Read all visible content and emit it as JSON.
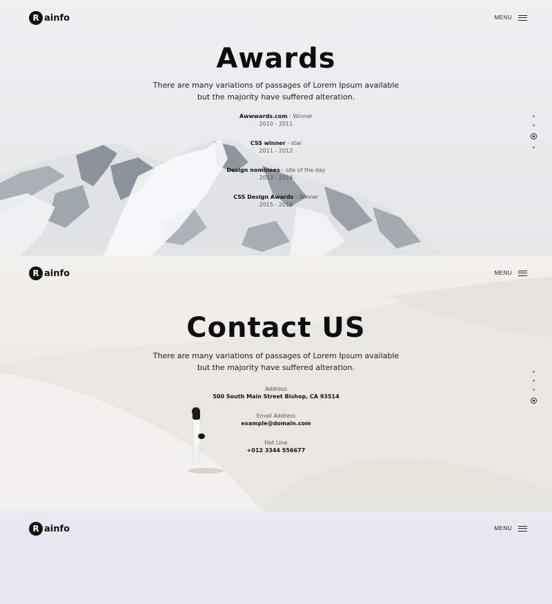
{
  "brand": {
    "logo_letter": "R",
    "logo_text": "ainfo"
  },
  "menu": {
    "label": "MENU"
  },
  "awards": {
    "title": "Awards",
    "subtitle": "There are many variations of passages of Lorem Ipsum available but the majority have suffered alteration.",
    "items": [
      {
        "name": "Awwwards.com",
        "sep": " - ",
        "role": "Winner",
        "years": "2010 - 2011"
      },
      {
        "name": "CSS winner",
        "sep": " - ",
        "role": "star",
        "years": "2011 - 2012"
      },
      {
        "name": "Design nominees",
        "sep": " - ",
        "role": "site of the day",
        "years": "2013 - 2014"
      },
      {
        "name": "CSS Design Awards",
        "sep": " - ",
        "role": "Winner",
        "years": "2015 - 2016"
      }
    ]
  },
  "contact": {
    "title": "Contact US",
    "subtitle": "There are many variations of passages of Lorem Ipsum available but the majority have suffered alteration.",
    "items": [
      {
        "label": "Address",
        "value": "500 South Main Street Bishop, CA 93514"
      },
      {
        "label": "Email Address",
        "value": "example@domain.com"
      },
      {
        "label": "Hot Line",
        "value": "+012 3344 556677"
      }
    ]
  },
  "colors": {
    "text": "#0d0d0d",
    "muted": "#555555",
    "mountain_shadow": "#6f7880",
    "snow": "#f4f6f7",
    "sand": "#ece9e4"
  },
  "icons": {
    "menu": "hamburger-icon",
    "pagination_active": "radio-dot-icon"
  }
}
